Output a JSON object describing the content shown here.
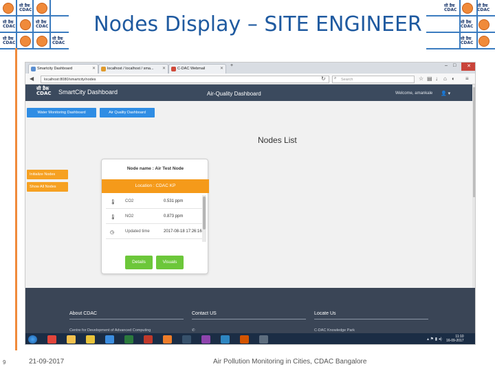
{
  "slide": {
    "title": "Nodes Display – SITE ENGINEER",
    "page_number": "9",
    "date": "21-09-2017",
    "footer": "Air Pollution Monitoring in Cities, CDAC Bangalore",
    "logo_text": "सी डैक\nCDAC"
  },
  "browser": {
    "tabs": [
      {
        "label": "Smartcity Dashboard"
      },
      {
        "label": "localhost / localhost / sma..."
      },
      {
        "label": "C-DAC Webmail"
      }
    ],
    "new_tab": "+",
    "url": "localhost:8080/smartcity/nodes",
    "search_placeholder": "Search"
  },
  "navbar": {
    "logo": "सी डैक\nCDAC",
    "brand": "SmartCity Dashboard",
    "center_title": "Air-Quality Dashboard",
    "welcome": "Welcome, amankale"
  },
  "buttons": {
    "water": "Water Monitoring Dashboard",
    "air": "Air Quality Dashboard",
    "initialize": "Initialize Nodes",
    "show_all": "Show All Nodes"
  },
  "main": {
    "heading": "Nodes List"
  },
  "node_card": {
    "title": "Node name : Air Test Node",
    "location": "Location : CDAC KP",
    "rows": [
      {
        "label": "CO2",
        "value": "0.531 ppm"
      },
      {
        "label": "NO2",
        "value": "0.873 ppm"
      },
      {
        "label": "Updated time",
        "value": "2017-08-18 17:26:16"
      }
    ],
    "details_label": "Details",
    "visuals_label": "Visuals"
  },
  "footer": {
    "columns": [
      {
        "title": "About CDAC",
        "sub": "Centre for Development of Advanced Computing"
      },
      {
        "title": "Contact US",
        "sub": ""
      },
      {
        "title": "Locate Us",
        "sub": "C-DAC Knowledge Park"
      }
    ]
  },
  "taskbar": {
    "time": "11:10",
    "date": "16-09-2017"
  },
  "colors": {
    "title_blue": "#1f5aa0",
    "navbar": "#3b4a5e",
    "button_blue": "#2f8de4",
    "button_orange": "#f6a122",
    "location_orange": "#f59a1a",
    "button_green": "#6cc73a",
    "footer": "#3a4556",
    "taskbar": "#1b2d45"
  }
}
